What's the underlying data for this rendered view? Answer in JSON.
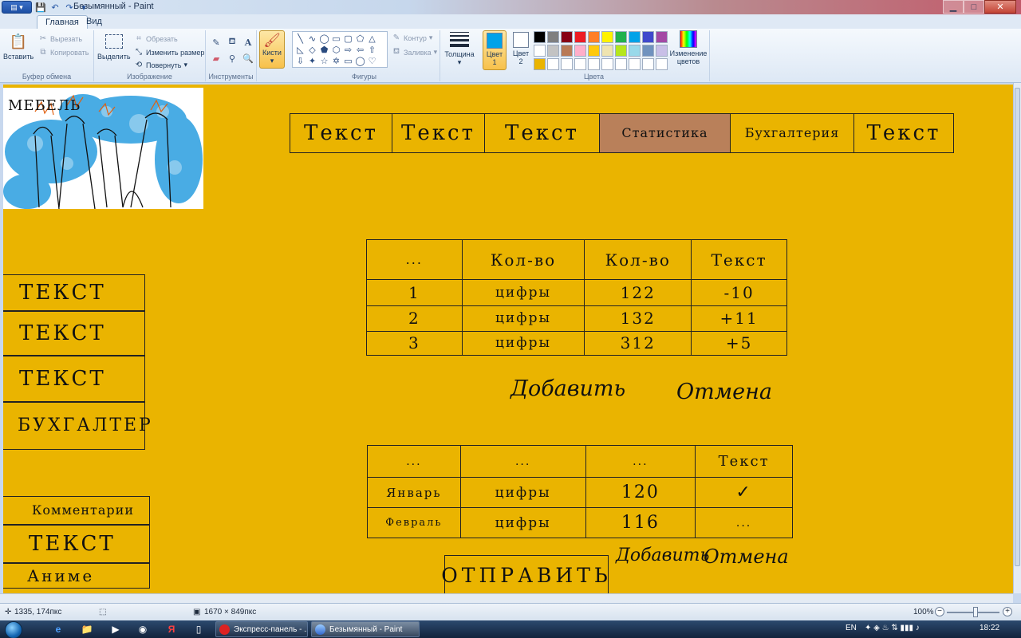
{
  "window": {
    "title": "Безымянный - Paint"
  },
  "tabs": [
    {
      "label": "Главная",
      "active": true
    },
    {
      "label": "Вид",
      "active": false
    }
  ],
  "ribbon": {
    "clipboard": {
      "paste": "Вставить",
      "cut": "Вырезать",
      "copy": "Копировать",
      "label": "Буфер обмена"
    },
    "image": {
      "select": "Выделить",
      "crop": "Обрезать",
      "resize": "Изменить размер",
      "rotate": "Повернуть",
      "label": "Изображение"
    },
    "tools": {
      "label": "Инструменты"
    },
    "brushes": {
      "label": "Кисти"
    },
    "shapes": {
      "outline": "Контур",
      "fill": "Заливка",
      "label": "Фигуры"
    },
    "size": {
      "label": "Толщина"
    },
    "colors": {
      "color1": "Цвет",
      "color1_num": "1",
      "color2": "Цвет",
      "color2_num": "2",
      "color1_value": "#00a2e8",
      "color2_value": "#ffffff",
      "edit": "Изменение цветов",
      "label": "Цвета",
      "palette": [
        "#000000",
        "#7f7f7f",
        "#880015",
        "#ed1c24",
        "#ff7f27",
        "#fff200",
        "#22b14c",
        "#00a2e8",
        "#3f48cc",
        "#a349a4",
        "#ffffff",
        "#c3c3c3",
        "#b97a57",
        "#ffaec9",
        "#ffc90e",
        "#efe4b0",
        "#b5e61d",
        "#99d9ea",
        "#7092be",
        "#c8bfe7",
        "#eab400",
        "#ffffff",
        "#ffffff",
        "#ffffff",
        "#ffffff",
        "#ffffff",
        "#ffffff",
        "#ffffff",
        "#ffffff",
        "#ffffff"
      ]
    }
  },
  "canvas": {
    "background": "#eab400",
    "sketch_text": "МЕБЕЛЬ",
    "nav": [
      {
        "label": "Текст",
        "active": false
      },
      {
        "label": "Текст",
        "active": false
      },
      {
        "label": "Текст",
        "active": false
      },
      {
        "label": "Статистика",
        "active": true
      },
      {
        "label": "Бухгалтерия",
        "active": false
      },
      {
        "label": "Текст",
        "active": false
      }
    ],
    "side_menu_top": [
      "ТЕКСТ",
      "ТЕКСТ",
      "ТЕКСТ",
      "БУХГАЛТЕР"
    ],
    "side_menu_bottom": [
      "Комментарии",
      "ТЕКСТ",
      "Аниме"
    ],
    "table1": {
      "headers": [
        "...",
        "Кол-во",
        "Кол-во",
        "Текст"
      ],
      "rows": [
        [
          "1",
          "цифры",
          "122",
          "-10"
        ],
        [
          "2",
          "цифры",
          "132",
          "+11"
        ],
        [
          "3",
          "цифры",
          "312",
          "+5"
        ]
      ]
    },
    "table1_actions": {
      "add": "Добавить",
      "cancel": "Отмена"
    },
    "table2": {
      "headers": [
        "...",
        "...",
        "...",
        "Текст"
      ],
      "rows": [
        [
          "Январь",
          "цифры",
          "120",
          "✓"
        ],
        [
          "Февраль",
          "цифры",
          "116",
          "..."
        ]
      ]
    },
    "submit": "ОТПРАВИТЬ",
    "table2_actions": {
      "add": "Добавить",
      "cancel": "Отмена"
    }
  },
  "status": {
    "cursor": "1335, 174пкс",
    "dimensions": "1670 × 849пкс",
    "zoom": "100%"
  },
  "taskbar": {
    "tasks": [
      {
        "label": "Экспресс-панель - ...",
        "active": false
      },
      {
        "label": "Безымянный - Paint",
        "active": true
      }
    ],
    "lang": "EN",
    "time": "18:22"
  }
}
